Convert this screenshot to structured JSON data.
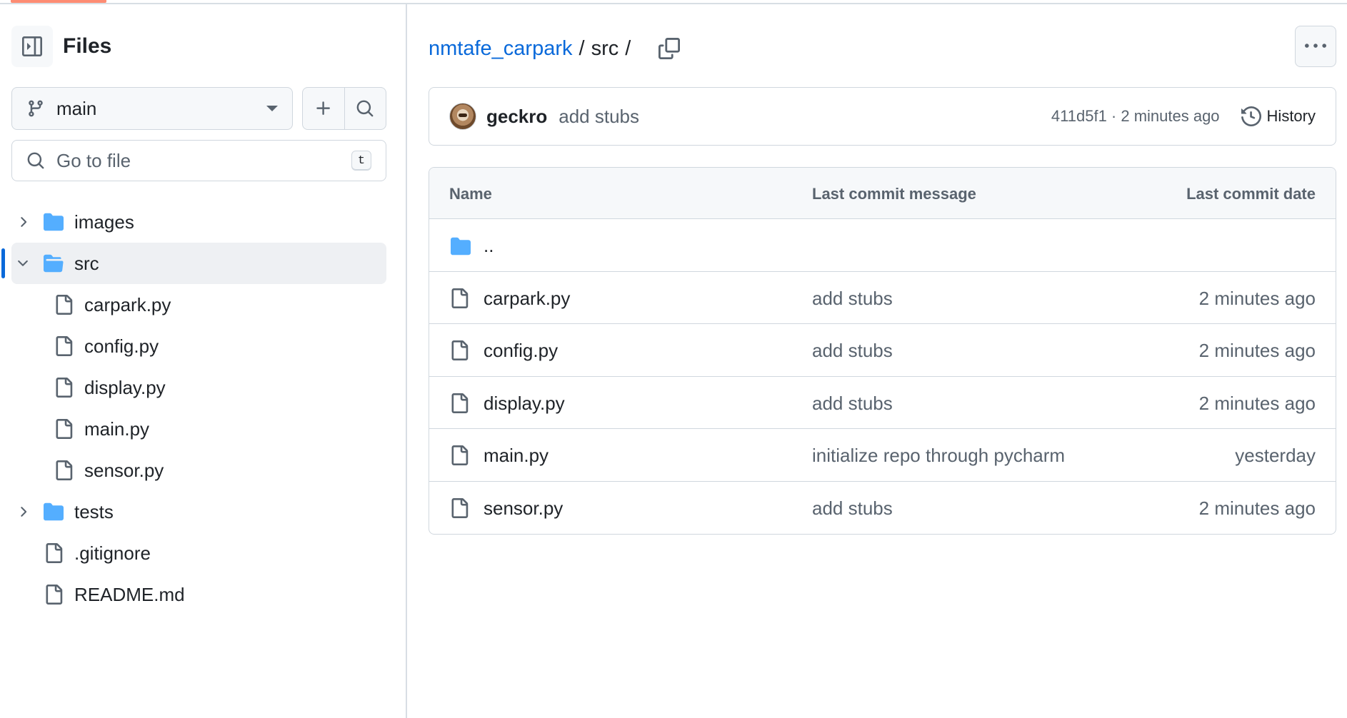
{
  "colors": {
    "accent": "#0969da",
    "folder": "#54aeff",
    "tab_accent": "#fd8c73",
    "muted": "#59636e",
    "border": "#d0d7de"
  },
  "sidebar": {
    "title": "Files",
    "branch": "main",
    "goto_placeholder": "Go to file",
    "goto_shortcut": "t",
    "tree": [
      {
        "label": "images",
        "type": "folder",
        "expanded": false,
        "level": 0,
        "icon": "folder-icon"
      },
      {
        "label": "src",
        "type": "folder",
        "expanded": true,
        "level": 0,
        "selected": true,
        "icon": "folder-open-icon"
      },
      {
        "label": "carpark.py",
        "type": "file",
        "level": 1,
        "icon": "file-icon"
      },
      {
        "label": "config.py",
        "type": "file",
        "level": 1,
        "icon": "file-icon"
      },
      {
        "label": "display.py",
        "type": "file",
        "level": 1,
        "icon": "file-icon"
      },
      {
        "label": "main.py",
        "type": "file",
        "level": 1,
        "icon": "file-icon"
      },
      {
        "label": "sensor.py",
        "type": "file",
        "level": 1,
        "icon": "file-icon"
      },
      {
        "label": "tests",
        "type": "folder",
        "expanded": false,
        "level": 0,
        "icon": "folder-icon"
      },
      {
        "label": ".gitignore",
        "type": "file",
        "level": 0,
        "icon": "file-icon"
      },
      {
        "label": "README.md",
        "type": "file",
        "level": 0,
        "icon": "file-icon"
      }
    ]
  },
  "breadcrumb": {
    "repo": "nmtafe_carpark",
    "sep1": "/",
    "dir": "src",
    "sep2": "/"
  },
  "commit": {
    "author": "geckro",
    "message": "add stubs",
    "meta": "411d5f1 · 2 minutes ago",
    "history_label": "History"
  },
  "table": {
    "headers": {
      "name": "Name",
      "message": "Last commit message",
      "date": "Last commit date"
    },
    "parent_label": "..",
    "rows": [
      {
        "name": "carpark.py",
        "message": "add stubs",
        "date": "2 minutes ago"
      },
      {
        "name": "config.py",
        "message": "add stubs",
        "date": "2 minutes ago"
      },
      {
        "name": "display.py",
        "message": "add stubs",
        "date": "2 minutes ago"
      },
      {
        "name": "main.py",
        "message": "initialize repo through pycharm",
        "date": "yesterday"
      },
      {
        "name": "sensor.py",
        "message": "add stubs",
        "date": "2 minutes ago"
      }
    ]
  }
}
